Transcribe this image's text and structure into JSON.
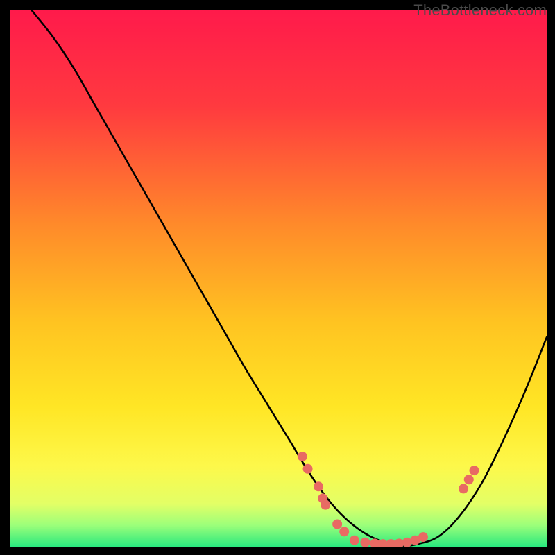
{
  "watermark": "TheBottleneck.com",
  "chart_data": {
    "type": "line",
    "title": "",
    "xlabel": "",
    "ylabel": "",
    "xlim": [
      0,
      100
    ],
    "ylim": [
      0,
      100
    ],
    "grid": false,
    "legend": false,
    "gradient_stops": [
      {
        "offset": 0,
        "color": "#ff1a4b"
      },
      {
        "offset": 18,
        "color": "#ff3a3f"
      },
      {
        "offset": 40,
        "color": "#ff8a2a"
      },
      {
        "offset": 58,
        "color": "#ffc321"
      },
      {
        "offset": 74,
        "color": "#ffe625"
      },
      {
        "offset": 85,
        "color": "#fdf84a"
      },
      {
        "offset": 92,
        "color": "#e3ff66"
      },
      {
        "offset": 96,
        "color": "#9cff7a"
      },
      {
        "offset": 100,
        "color": "#29e87e"
      }
    ],
    "series": [
      {
        "name": "bottleneck-curve",
        "color": "#000000",
        "x": [
          4,
          8,
          12,
          16,
          20,
          24,
          28,
          32,
          36,
          40,
          44,
          48,
          52,
          55,
          58,
          61,
          64,
          67,
          70,
          73,
          76,
          80,
          84,
          88,
          92,
          96,
          100
        ],
        "y": [
          100,
          95,
          89,
          82,
          75,
          68,
          61,
          54,
          47,
          40,
          33,
          26.5,
          20,
          15,
          10.5,
          6.8,
          4,
          2,
          0.8,
          0.2,
          0.5,
          2,
          6,
          12,
          20,
          29,
          39
        ]
      }
    ],
    "scatter": {
      "name": "markers",
      "color": "#e86a63",
      "radius": 7,
      "points": [
        {
          "x": 54.5,
          "y": 16.8
        },
        {
          "x": 55.5,
          "y": 14.5
        },
        {
          "x": 57.5,
          "y": 11.2
        },
        {
          "x": 58.3,
          "y": 9.0
        },
        {
          "x": 58.8,
          "y": 7.8
        },
        {
          "x": 61.0,
          "y": 4.2
        },
        {
          "x": 62.3,
          "y": 2.8
        },
        {
          "x": 64.2,
          "y": 1.2
        },
        {
          "x": 66.2,
          "y": 0.8
        },
        {
          "x": 68.0,
          "y": 0.6
        },
        {
          "x": 69.5,
          "y": 0.5
        },
        {
          "x": 71.0,
          "y": 0.5
        },
        {
          "x": 72.5,
          "y": 0.6
        },
        {
          "x": 74.0,
          "y": 0.8
        },
        {
          "x": 75.5,
          "y": 1.2
        },
        {
          "x": 77.0,
          "y": 1.8
        },
        {
          "x": 84.5,
          "y": 10.8
        },
        {
          "x": 85.5,
          "y": 12.5
        },
        {
          "x": 86.5,
          "y": 14.2
        }
      ]
    }
  }
}
